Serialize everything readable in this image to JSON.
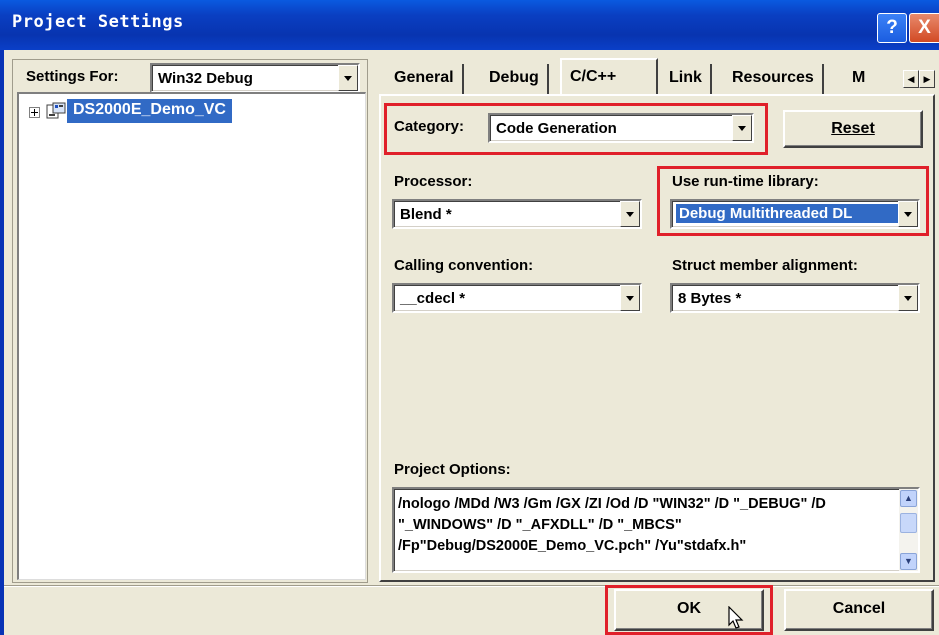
{
  "window": {
    "title": "Project Settings",
    "help_label": "?",
    "close_label": "X"
  },
  "settings_for": {
    "label": "Settings For:",
    "value": "Win32 Debug"
  },
  "tree": {
    "project_name": "DS2000E_Demo_VC"
  },
  "tabs": [
    "General",
    "Debug",
    "C/C++",
    "Link",
    "Resources",
    "M"
  ],
  "active_tab": "C/C++",
  "category": {
    "label": "Category:",
    "value": "Code Generation"
  },
  "reset_label": "Reset",
  "processor": {
    "label": "Processor:",
    "value": "Blend *"
  },
  "runtime_library": {
    "label": "Use run-time library:",
    "value": "Debug Multithreaded DL"
  },
  "calling_convention": {
    "label": "Calling convention:",
    "value": "__cdecl *"
  },
  "struct_alignment": {
    "label": "Struct member alignment:",
    "value": "8 Bytes *"
  },
  "project_options": {
    "label": "Project Options:",
    "text": "/nologo /MDd /W3 /Gm /GX /ZI /Od /D \"WIN32\" /D \"_DEBUG\" /D \"_WINDOWS\" /D \"_AFXDLL\" /D \"_MBCS\" /Fp\"Debug/DS2000E_Demo_VC.pch\" /Yu\"stdafx.h\""
  },
  "buttons": {
    "ok": "OK",
    "cancel": "Cancel"
  },
  "highlight_color": "#e0202a",
  "selection_color": "#316ac5"
}
